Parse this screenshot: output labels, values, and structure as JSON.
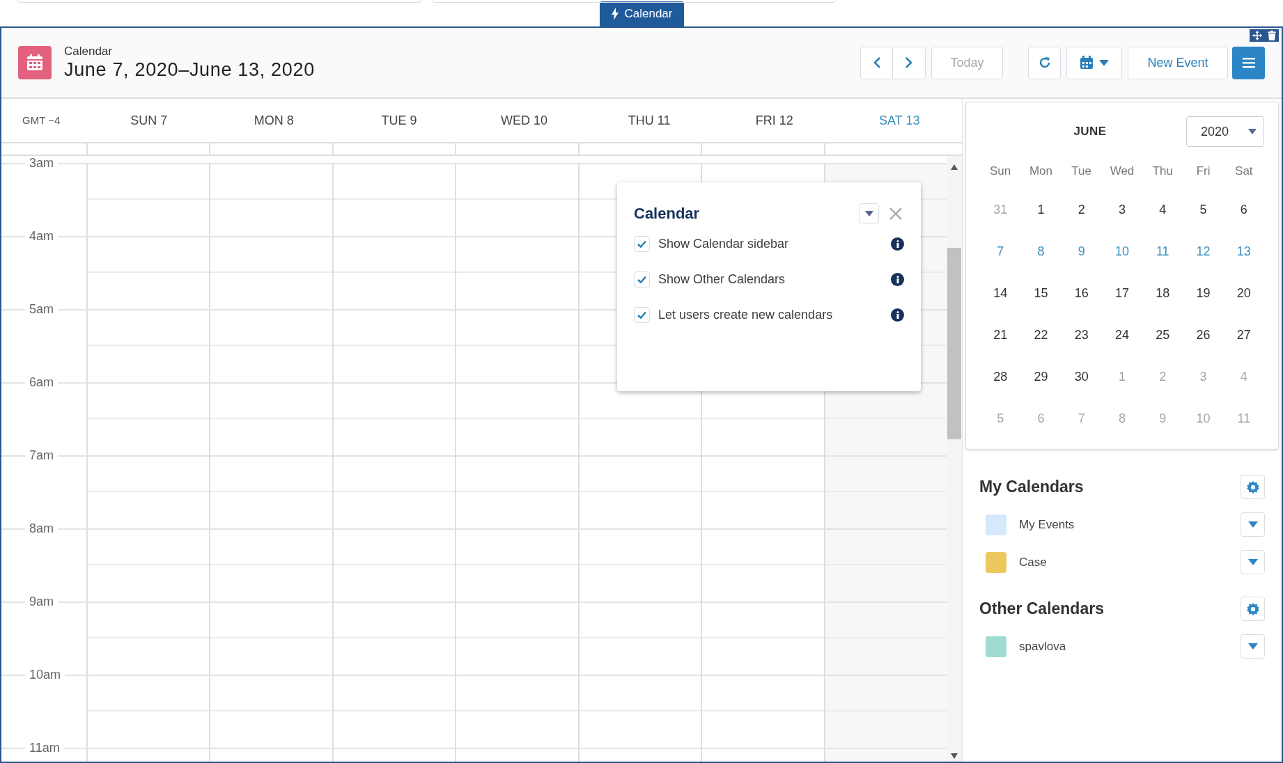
{
  "top_tab": {
    "label": "Calendar"
  },
  "header": {
    "subtitle": "Calendar",
    "title": "June 7, 2020–June 13, 2020",
    "today_button": {
      "label": "Today",
      "disabled": true
    },
    "new_event_button": {
      "label": "New Event"
    }
  },
  "week": {
    "timezone": "GMT −4",
    "days": [
      {
        "label": "SUN 7",
        "selected": false
      },
      {
        "label": "MON 8",
        "selected": false
      },
      {
        "label": "TUE 9",
        "selected": false
      },
      {
        "label": "WED 10",
        "selected": false
      },
      {
        "label": "THU 11",
        "selected": false
      },
      {
        "label": "FRI 12",
        "selected": false
      },
      {
        "label": "SAT 13",
        "selected": true
      }
    ],
    "hours": [
      "3am",
      "4am",
      "5am",
      "6am",
      "7am",
      "8am",
      "9am",
      "10am",
      "11am"
    ]
  },
  "popup": {
    "title": "Calendar",
    "options": [
      {
        "label": "Show Calendar sidebar",
        "checked": true
      },
      {
        "label": "Show Other Calendars",
        "checked": true
      },
      {
        "label": "Let users create new calendars",
        "checked": true
      }
    ]
  },
  "mini_calendar": {
    "month": "JUNE",
    "year": "2020",
    "weekdays": [
      "Sun",
      "Mon",
      "Tue",
      "Wed",
      "Thu",
      "Fri",
      "Sat"
    ],
    "weeks": [
      [
        {
          "day": "31",
          "kind": "outside"
        },
        {
          "day": "1",
          "kind": "normal"
        },
        {
          "day": "2",
          "kind": "normal"
        },
        {
          "day": "3",
          "kind": "normal"
        },
        {
          "day": "4",
          "kind": "normal"
        },
        {
          "day": "5",
          "kind": "normal"
        },
        {
          "day": "6",
          "kind": "normal"
        }
      ],
      [
        {
          "day": "7",
          "kind": "current_week"
        },
        {
          "day": "8",
          "kind": "current_week"
        },
        {
          "day": "9",
          "kind": "current_week"
        },
        {
          "day": "10",
          "kind": "current_week"
        },
        {
          "day": "11",
          "kind": "current_week"
        },
        {
          "day": "12",
          "kind": "current_week"
        },
        {
          "day": "13",
          "kind": "current_week"
        }
      ],
      [
        {
          "day": "14",
          "kind": "normal"
        },
        {
          "day": "15",
          "kind": "normal"
        },
        {
          "day": "16",
          "kind": "normal"
        },
        {
          "day": "17",
          "kind": "normal"
        },
        {
          "day": "18",
          "kind": "normal"
        },
        {
          "day": "19",
          "kind": "normal"
        },
        {
          "day": "20",
          "kind": "normal"
        }
      ],
      [
        {
          "day": "21",
          "kind": "normal"
        },
        {
          "day": "22",
          "kind": "normal"
        },
        {
          "day": "23",
          "kind": "normal"
        },
        {
          "day": "24",
          "kind": "normal"
        },
        {
          "day": "25",
          "kind": "normal"
        },
        {
          "day": "26",
          "kind": "normal"
        },
        {
          "day": "27",
          "kind": "normal"
        }
      ],
      [
        {
          "day": "28",
          "kind": "normal"
        },
        {
          "day": "29",
          "kind": "normal"
        },
        {
          "day": "30",
          "kind": "normal"
        },
        {
          "day": "1",
          "kind": "outside"
        },
        {
          "day": "2",
          "kind": "outside"
        },
        {
          "day": "3",
          "kind": "outside"
        },
        {
          "day": "4",
          "kind": "outside"
        }
      ],
      [
        {
          "day": "5",
          "kind": "outside"
        },
        {
          "day": "6",
          "kind": "outside"
        },
        {
          "day": "7",
          "kind": "outside"
        },
        {
          "day": "8",
          "kind": "outside"
        },
        {
          "day": "9",
          "kind": "outside"
        },
        {
          "day": "10",
          "kind": "outside"
        },
        {
          "day": "11",
          "kind": "outside"
        }
      ]
    ]
  },
  "calendar_groups": [
    {
      "title": "My Calendars",
      "items": [
        {
          "name": "My Events",
          "color": "#d4e9fb"
        },
        {
          "name": "Case",
          "color": "#ecc95e"
        }
      ]
    },
    {
      "title": "Other Calendars",
      "items": [
        {
          "name": "spavlova",
          "color": "#9fdccf"
        }
      ]
    }
  ]
}
